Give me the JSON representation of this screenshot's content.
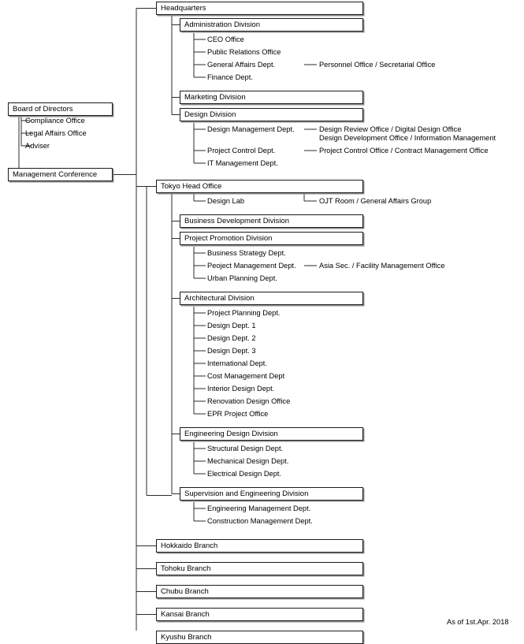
{
  "meta": {
    "footer_note": "As of 1st.Apr. 2018",
    "line_color": "#2b2b2b",
    "box_border_color": "#1a1a1a",
    "box_shadow_color": "#8e8e8e",
    "background_color": "#ffffff",
    "text_color": "#000000"
  },
  "governance": {
    "board_of_directors": "Board of Directors",
    "board_children": [
      "Compliance Office",
      "Legal Affairs Office",
      "Adviser"
    ],
    "management_conference": "Management Conference"
  },
  "headquarters": {
    "title": "Headquarters",
    "divisions": [
      {
        "name": "Administration Division",
        "departments": [
          {
            "name": "CEO Office",
            "units": []
          },
          {
            "name": "Public Relations Office",
            "units": []
          },
          {
            "name": "General Affairs Dept.",
            "units": [
              "Personnel Office / Secretarial Office"
            ]
          },
          {
            "name": "Finance Dept.",
            "units": []
          }
        ]
      },
      {
        "name": "Marketing Division",
        "departments": []
      },
      {
        "name": "Design Division",
        "departments": [
          {
            "name": "Design Management Dept.",
            "units": [
              "Design Review Office / Digital Design Office",
              "Design Development Office / Information Management"
            ]
          },
          {
            "name": "Project Control Dept.",
            "units": [
              "Project Control Office / Contract Management Office"
            ]
          },
          {
            "name": "IT Management Dept.",
            "units": []
          }
        ]
      }
    ]
  },
  "tokyo_head_office": {
    "title": "Tokyo Head Office",
    "direct_departments": [
      {
        "name": "Design Lab",
        "units": [
          "OJT Room / General Affairs Group"
        ]
      }
    ],
    "divisions": [
      {
        "name": "Business Development Division",
        "departments": []
      },
      {
        "name": "Project Promotion Division",
        "departments": [
          {
            "name": "Business Strategy Dept.",
            "units": []
          },
          {
            "name": "Peoject Management Dept.",
            "units": [
              "Asia Sec. / Facility Management Office"
            ]
          },
          {
            "name": "Urban Planning Dept.",
            "units": []
          }
        ]
      },
      {
        "name": "Architectural Division",
        "departments": [
          {
            "name": "Project Planning Dept.",
            "units": []
          },
          {
            "name": "Design Dept. 1",
            "units": []
          },
          {
            "name": "Design Dept. 2",
            "units": []
          },
          {
            "name": "Design Dept. 3",
            "units": []
          },
          {
            "name": "International Dept.",
            "units": []
          },
          {
            "name": "Cost Management Dept",
            "units": []
          },
          {
            "name": "Interior Design Dept.",
            "units": []
          },
          {
            "name": "Renovation Design Office",
            "units": []
          },
          {
            "name": "EPR Project Office",
            "units": []
          }
        ]
      },
      {
        "name": "Engineering Design Division",
        "departments": [
          {
            "name": "Structural Design Dept.",
            "units": []
          },
          {
            "name": "Mechanical Design Dept.",
            "units": []
          },
          {
            "name": "Electrical Design Dept.",
            "units": []
          }
        ]
      },
      {
        "name": "Supervision and Engineering Division",
        "departments": [
          {
            "name": "Engineering Management Dept.",
            "units": []
          },
          {
            "name": "Construction Management Dept.",
            "units": []
          }
        ]
      }
    ]
  },
  "branches": [
    "Hokkaido Branch",
    "Tohoku Branch",
    "Chubu Branch",
    "Kansai Branch",
    "Kyushu Branch"
  ]
}
